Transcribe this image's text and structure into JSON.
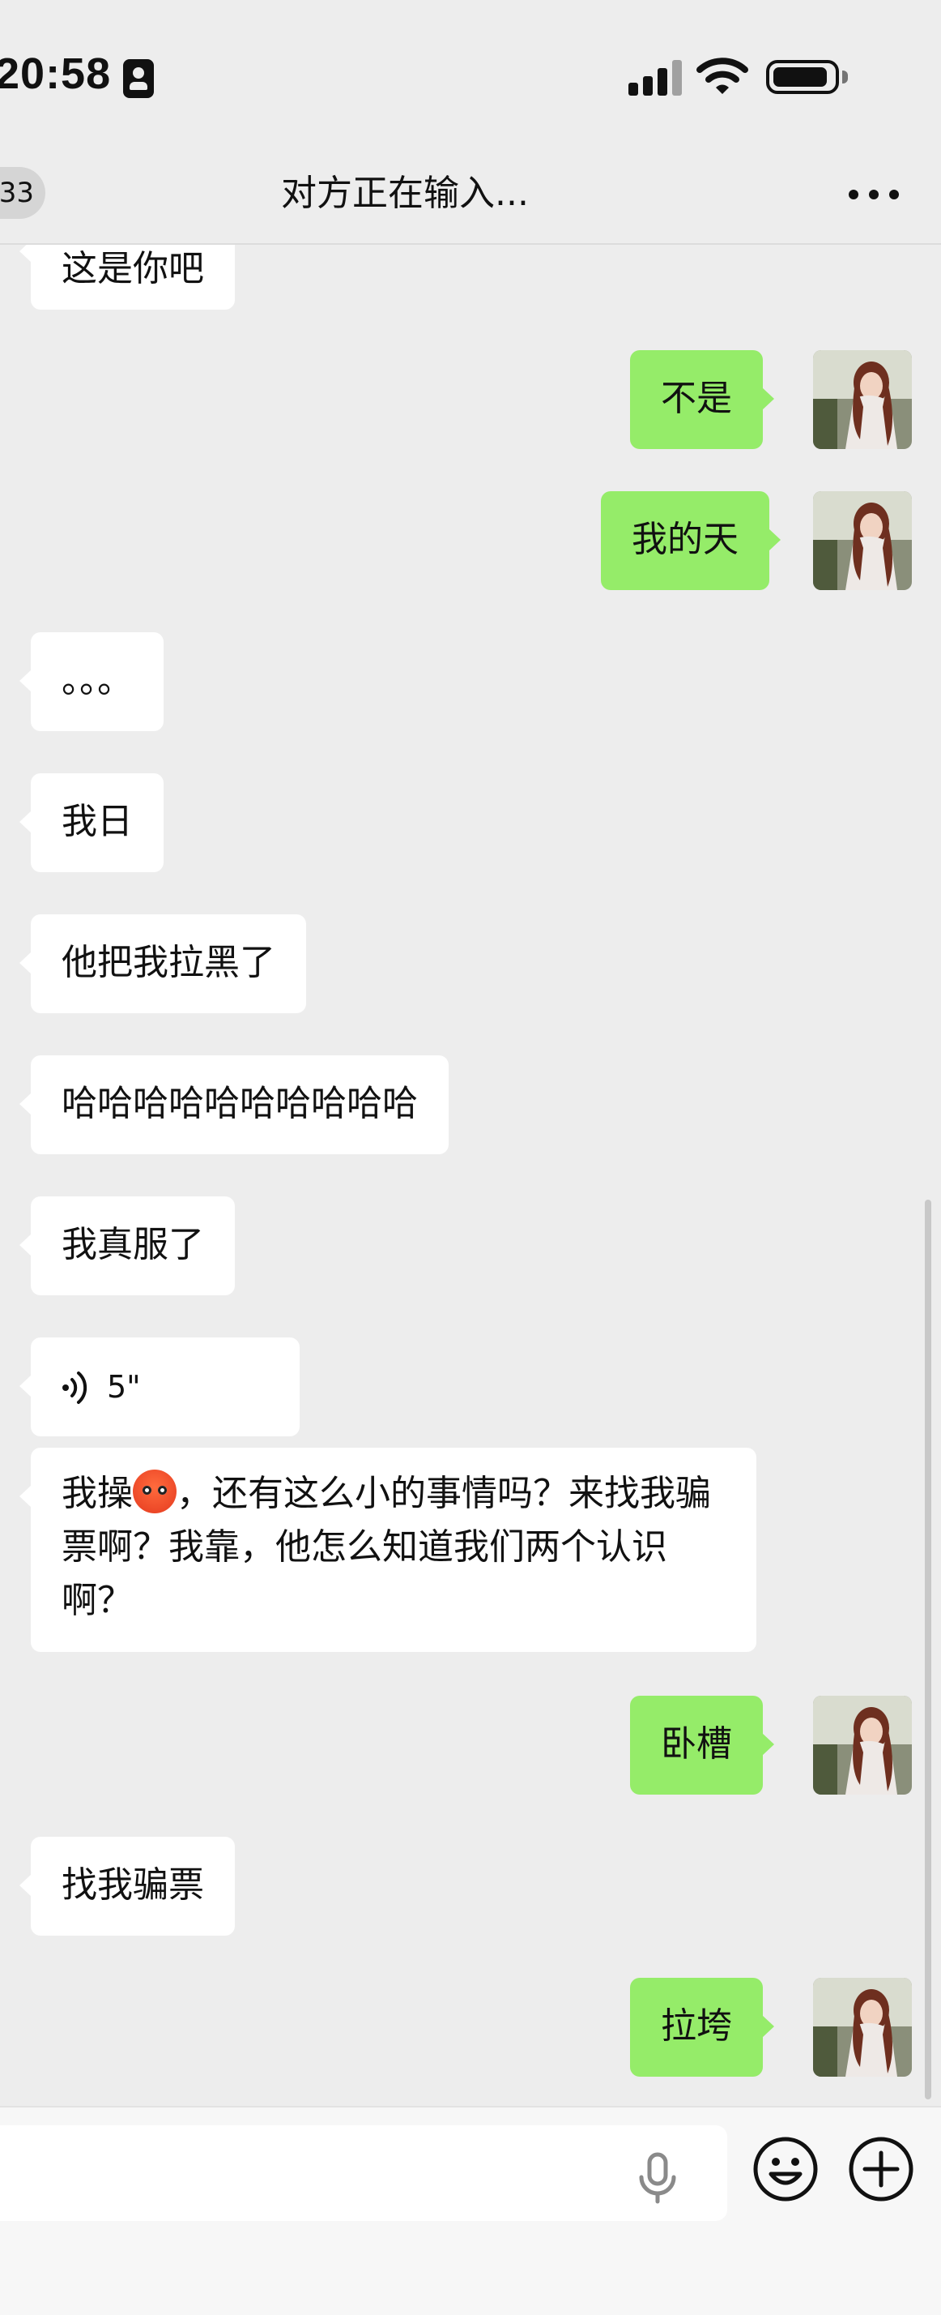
{
  "status_bar": {
    "time": "20:58"
  },
  "header": {
    "back_count": "33",
    "title": "对方正在输入..."
  },
  "messages": [
    {
      "side": "in",
      "text": "这是你吧"
    },
    {
      "side": "out",
      "text": "不是"
    },
    {
      "side": "out",
      "text": "我的天"
    },
    {
      "side": "in",
      "text": "。。。"
    },
    {
      "side": "in",
      "text": "我日"
    },
    {
      "side": "in",
      "text": "他把我拉黑了"
    },
    {
      "side": "in",
      "text": "哈哈哈哈哈哈哈哈哈哈"
    },
    {
      "side": "in",
      "text": "我真服了"
    },
    {
      "side": "in",
      "type": "voice",
      "duration": "5\""
    },
    {
      "side": "in",
      "text_before_emoji": "我操",
      "emoji": "angry-face-emoji",
      "text_after_emoji": "，还有这么小的事情吗？来找我骗票啊？我靠，他怎么知道我们两个认识啊？"
    },
    {
      "side": "out",
      "text": "卧槽"
    },
    {
      "side": "in",
      "text": "找我骗票"
    },
    {
      "side": "out",
      "text": "拉垮"
    }
  ],
  "colors": {
    "background": "#ededed",
    "incoming_bubble": "#ffffff",
    "outgoing_bubble": "#95ec69",
    "input_bar": "#f7f7f7"
  },
  "icons": {
    "header_more": "more-dots-icon",
    "voice": "voice-wave-icon",
    "mic": "microphone-icon",
    "emoji": "emoji-face-icon",
    "plus": "plus-circle-icon"
  }
}
